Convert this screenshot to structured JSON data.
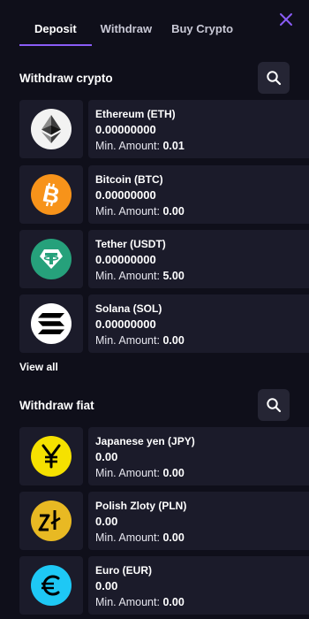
{
  "tabs": [
    {
      "label": "Deposit"
    },
    {
      "label": "Withdraw"
    },
    {
      "label": "Buy Crypto"
    }
  ],
  "crypto_section": {
    "title": "Withdraw crypto",
    "items": [
      {
        "name": "Ethereum (ETH)",
        "balance": "0.00000000",
        "min_label": "Min. Amount:",
        "min_value": "0.01",
        "icon": "ethereum-icon",
        "color": "#f2f2f2"
      },
      {
        "name": "Bitcoin (BTC)",
        "balance": "0.00000000",
        "min_label": "Min. Amount:",
        "min_value": "0.00",
        "icon": "bitcoin-icon",
        "color": "#f7931a"
      },
      {
        "name": "Tether (USDT)",
        "balance": "0.00000000",
        "min_label": "Min. Amount:",
        "min_value": "5.00",
        "icon": "tether-icon",
        "color": "#26a17b"
      },
      {
        "name": "Solana (SOL)",
        "balance": "0.00000000",
        "min_label": "Min. Amount:",
        "min_value": "0.00",
        "icon": "solana-icon",
        "color": "#ffffff"
      }
    ],
    "view_all": "View all"
  },
  "fiat_section": {
    "title": "Withdraw fiat",
    "items": [
      {
        "name": "Japanese yen (JPY)",
        "balance": "0.00",
        "min_label": "Min. Amount:",
        "min_value": "0.00",
        "icon": "yen-icon",
        "color": "#f5e100"
      },
      {
        "name": "Polish Zloty (PLN)",
        "balance": "0.00",
        "min_label": "Min. Amount:",
        "min_value": "0.00",
        "icon": "zloty-icon",
        "color": "#e8b923"
      },
      {
        "name": "Euro (EUR)",
        "balance": "0.00",
        "min_label": "Min. Amount:",
        "min_value": "0.00",
        "icon": "euro-icon",
        "color": "#1ec8f5"
      }
    ]
  },
  "colors": {
    "accent": "#8a5cf6",
    "background": "#0f0f1a",
    "card": "#1b1b2a",
    "button": "#252534"
  }
}
